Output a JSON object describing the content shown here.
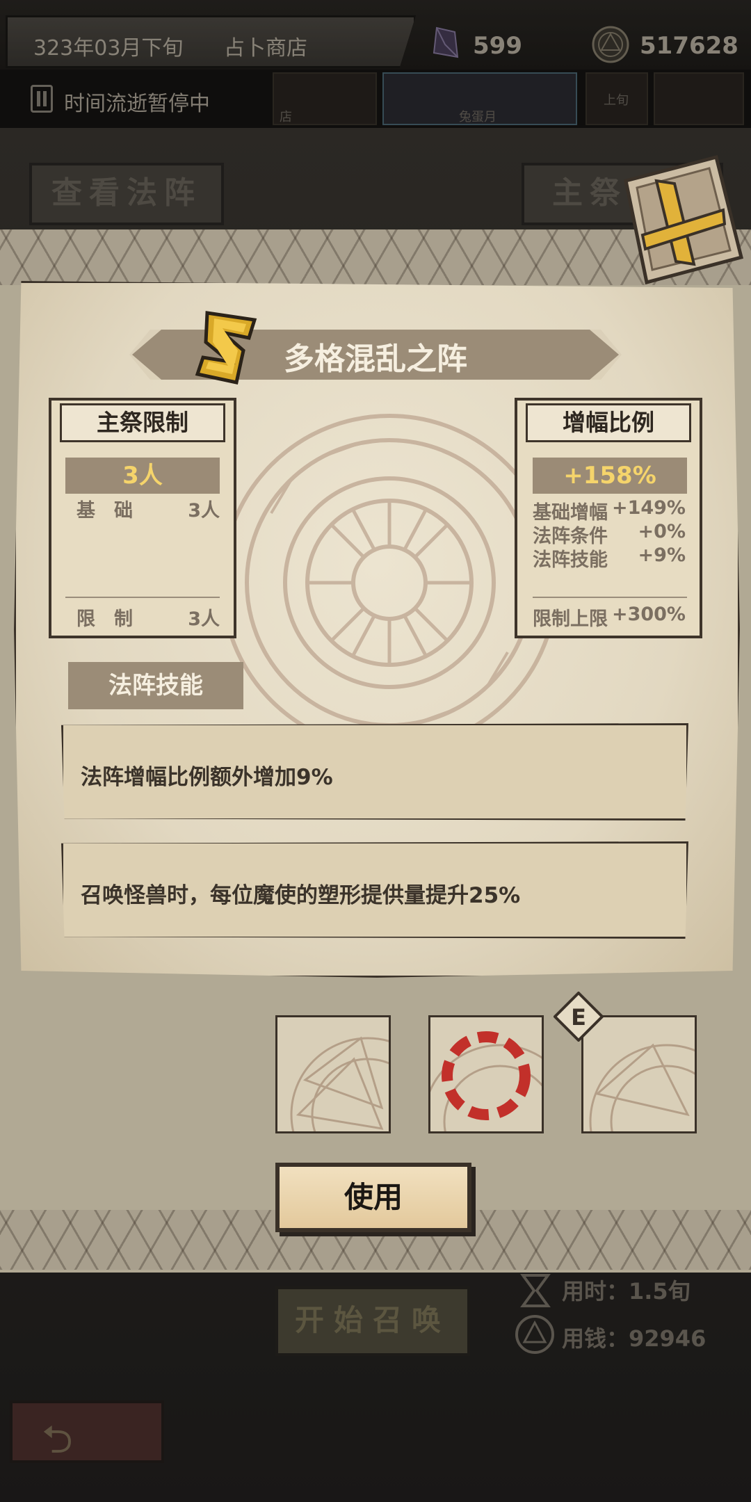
{
  "header": {
    "date": "323年03月下旬",
    "shop": "占卜商店",
    "gems": "599",
    "coins": "517628",
    "status": "时间流逝暂停中",
    "banners": [
      "店",
      "兔蛋月",
      "上旬"
    ]
  },
  "background": {
    "view_array_btn": "查看法阵",
    "main_priest_btn": "主祭",
    "start_summon_btn": "开始召唤",
    "time_cost": "用时：1.5旬",
    "money_cost": "用钱：92946"
  },
  "modal": {
    "title": "多格混乱之阵",
    "rank": "S",
    "priest_limit": {
      "header": "主祭限制",
      "value": "3人",
      "base_label": "基　础",
      "base_value": "3人",
      "limit_label": "限　制",
      "limit_value": "3人"
    },
    "amp_ratio": {
      "header": "增幅比例",
      "value": "+158%",
      "rows": [
        {
          "label": "基础增幅",
          "value": "+149%"
        },
        {
          "label": "法阵条件",
          "value": "+0%"
        },
        {
          "label": "法阵技能",
          "value": "+9%"
        }
      ],
      "cap_label": "限制上限",
      "cap_value": "+300%"
    },
    "skills_label": "法阵技能",
    "skills": [
      "法阵增幅比例额外增加9%",
      "召唤怪兽时，每位魔使的塑形提供量提升25%"
    ],
    "slot_badge": "E",
    "use_button": "使用"
  },
  "colors": {
    "accent_gold": "#f5d46b",
    "panel_brown": "#9b8c77",
    "parchment": "#e6dcc5",
    "ink": "#3a3128",
    "selection_red": "#c2302a"
  }
}
